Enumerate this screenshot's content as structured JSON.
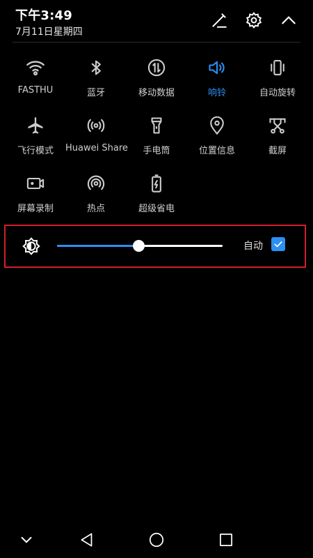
{
  "status": {
    "time": "下午3:49",
    "date": "7月11日星期四"
  },
  "header_icons": [
    "edit-icon",
    "settings-gear-icon",
    "collapse-chevron-up-icon"
  ],
  "tiles": [
    {
      "name": "wifi",
      "label": "FASTHU",
      "icon": "wifi-icon",
      "active": true
    },
    {
      "name": "bluetooth",
      "label": "蓝牙",
      "icon": "bluetooth-icon",
      "active": false
    },
    {
      "name": "mobile-data",
      "label": "移动数据",
      "icon": "mobile-data-icon",
      "active": false
    },
    {
      "name": "ring",
      "label": "响铃",
      "icon": "speaker-icon",
      "active": true
    },
    {
      "name": "auto-rotate",
      "label": "自动旋转",
      "icon": "rotate-icon",
      "active": false
    },
    {
      "name": "airplane",
      "label": "飞行模式",
      "icon": "airplane-icon",
      "active": false
    },
    {
      "name": "huawei-share",
      "label": "Huawei Share",
      "icon": "share-broadcast-icon",
      "active": false
    },
    {
      "name": "flashlight",
      "label": "手电筒",
      "icon": "flashlight-icon",
      "active": false
    },
    {
      "name": "location",
      "label": "位置信息",
      "icon": "location-pin-icon",
      "active": false
    },
    {
      "name": "screenshot",
      "label": "截屏",
      "icon": "screenshot-scissors-icon",
      "active": false
    },
    {
      "name": "screen-record",
      "label": "屏幕录制",
      "icon": "screen-record-icon",
      "active": false
    },
    {
      "name": "hotspot",
      "label": "热点",
      "icon": "hotspot-icon",
      "active": false
    },
    {
      "name": "power-saving",
      "label": "超级省电",
      "icon": "battery-saver-icon",
      "active": false
    }
  ],
  "brightness": {
    "level_percent": 49,
    "auto_label": "自动",
    "auto_checked": true
  },
  "colors": {
    "accent": "#2c8ff2",
    "highlight_border": "#d1202a",
    "background": "#000000"
  },
  "navbar": [
    "expand-chevron-down-icon",
    "back-triangle-icon",
    "home-circle-icon",
    "recents-square-icon"
  ]
}
